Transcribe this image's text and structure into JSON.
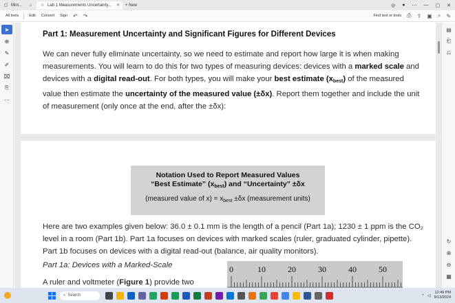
{
  "browser": {
    "tabs": [
      {
        "label": "Mini..."
      },
      {
        "label": "Lab 1 Measurements Uncertainty..."
      },
      {
        "label": "+ New"
      }
    ]
  },
  "toolbar": {
    "items": [
      "All tools",
      "Edit",
      "Convert",
      "Sign"
    ],
    "right_label": "Find text or tools"
  },
  "document": {
    "heading": "Part 1: Measurement Uncertainty and Significant Figures for Different Devices",
    "intro": {
      "t1": "We can never fully eliminate uncertainty, so we need to estimate and report how large it is when making measurements. You will learn to do this for two types of measuring devices: devices with a ",
      "b1": "marked scale",
      "t2": " and devices with a ",
      "b2": "digital read-out",
      "t3": ". For both types, you will make your ",
      "b3": "best estimate",
      "b4": "(x",
      "b4_sub": "best",
      "b4_end": ")",
      "t4": " of the measured value then estimate the ",
      "b5": "uncertainty of the measured value (±δx)",
      "t5": ". Report them together and include the unit of measurement (only once at the end, after the ±δx):"
    },
    "notation": {
      "line1": "Notation Used to Report Measured Values",
      "line2a": "“Best Estimate” (x",
      "line2_sub": "best",
      "line2b": ") and “Uncertainty” ±δx",
      "line3a": "(measured value of x) = x",
      "line3_sub": "best",
      "line3b": " ±δx (measurement units)"
    },
    "examples": "Here are two examples given below: 36.0 ± 0.1 mm is the length of a pencil (Part 1a); 1230 ± 1 ppm is the CO₂ level in a room (Part 1b). Part 1a focuses on devices with marked scales (ruler, graduated cylinder, pipette). Part 1b focuses on devices with a digital read-out (balance, air quality monitors).",
    "part1a_title": "Part 1a: Devices with a Marked-Scale",
    "ruler_intro_a": "A ruler and voltmeter (",
    "ruler_intro_b": "Figure 1",
    "ruler_intro_c": ") provide two",
    "ruler_labels": [
      "0",
      "10",
      "20",
      "30",
      "40",
      "50"
    ]
  },
  "taskbar": {
    "search_placeholder": "Search",
    "time": "12:49 PM",
    "date": "9/13/2024"
  }
}
